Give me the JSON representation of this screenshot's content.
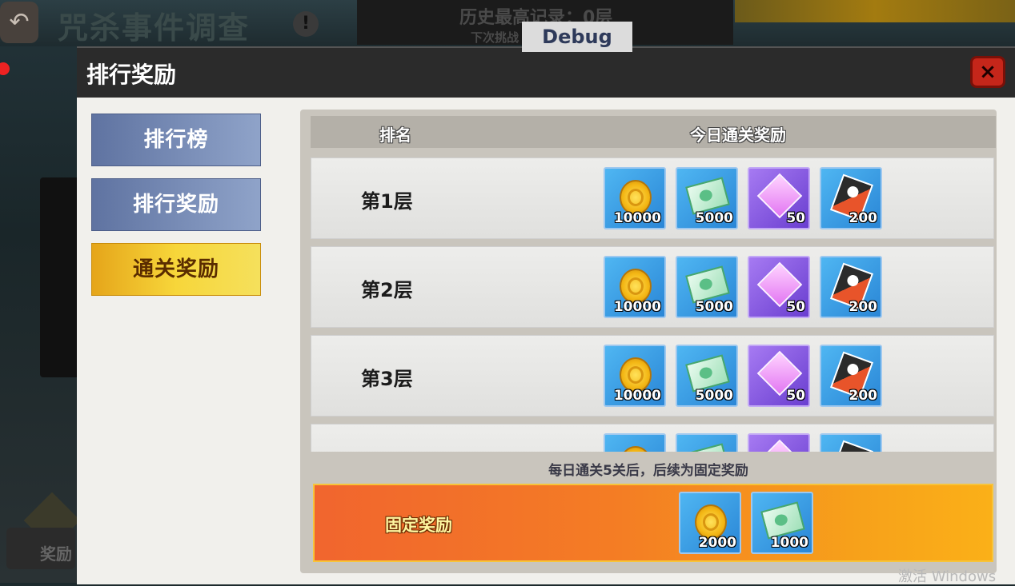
{
  "game_title": "咒杀事件调查",
  "back_icon": "back-arrow-icon",
  "info_icon_text": "!",
  "record": {
    "text": "历史最高记录：0层",
    "sub": "下次挑战"
  },
  "debug_label": "Debug",
  "reward_corner_label": "奖励",
  "modal": {
    "title": "排行奖励",
    "close_label": "×"
  },
  "tabs": [
    {
      "label": "排行榜",
      "active": false
    },
    {
      "label": "排行奖励",
      "active": false
    },
    {
      "label": "通关奖励",
      "active": true
    }
  ],
  "table": {
    "header_rank": "排名",
    "header_reward": "今日通关奖励",
    "rows": [
      {
        "label": "第1层",
        "rewards": [
          {
            "icon": "gold-coin-icon",
            "type": "coin",
            "qty": "10000"
          },
          {
            "icon": "green-ticket-icon",
            "type": "ticket",
            "qty": "5000"
          },
          {
            "icon": "purple-crystal-icon",
            "type": "crystal",
            "qty": "50"
          },
          {
            "icon": "card-icon",
            "type": "card",
            "qty": "200"
          }
        ]
      },
      {
        "label": "第2层",
        "rewards": [
          {
            "icon": "gold-coin-icon",
            "type": "coin",
            "qty": "10000"
          },
          {
            "icon": "green-ticket-icon",
            "type": "ticket",
            "qty": "5000"
          },
          {
            "icon": "purple-crystal-icon",
            "type": "crystal",
            "qty": "50"
          },
          {
            "icon": "card-icon",
            "type": "card",
            "qty": "200"
          }
        ]
      },
      {
        "label": "第3层",
        "rewards": [
          {
            "icon": "gold-coin-icon",
            "type": "coin",
            "qty": "10000"
          },
          {
            "icon": "green-ticket-icon",
            "type": "ticket",
            "qty": "5000"
          },
          {
            "icon": "purple-crystal-icon",
            "type": "crystal",
            "qty": "50"
          },
          {
            "icon": "card-icon",
            "type": "card",
            "qty": "200"
          }
        ]
      },
      {
        "label": "",
        "rewards": [
          {
            "icon": "gold-coin-icon",
            "type": "coin",
            "qty": ""
          },
          {
            "icon": "green-ticket-icon",
            "type": "ticket",
            "qty": ""
          },
          {
            "icon": "purple-crystal-icon",
            "type": "crystal",
            "qty": ""
          },
          {
            "icon": "card-icon",
            "type": "card",
            "qty": ""
          }
        ]
      }
    ]
  },
  "footer_note": "每日通关5关后，后续为固定奖励",
  "fixed": {
    "label": "固定奖励",
    "rewards": [
      {
        "icon": "gold-coin-icon",
        "type": "coin",
        "qty": "2000"
      },
      {
        "icon": "green-ticket-icon",
        "type": "ticket",
        "qty": "1000"
      }
    ]
  },
  "watermark": "激活 Windows",
  "colors": {
    "active_tab": "#f7d63a",
    "inactive_tab": "#7a8db8",
    "fixed_bar": "#f47d24",
    "close_button": "#c5261a"
  }
}
